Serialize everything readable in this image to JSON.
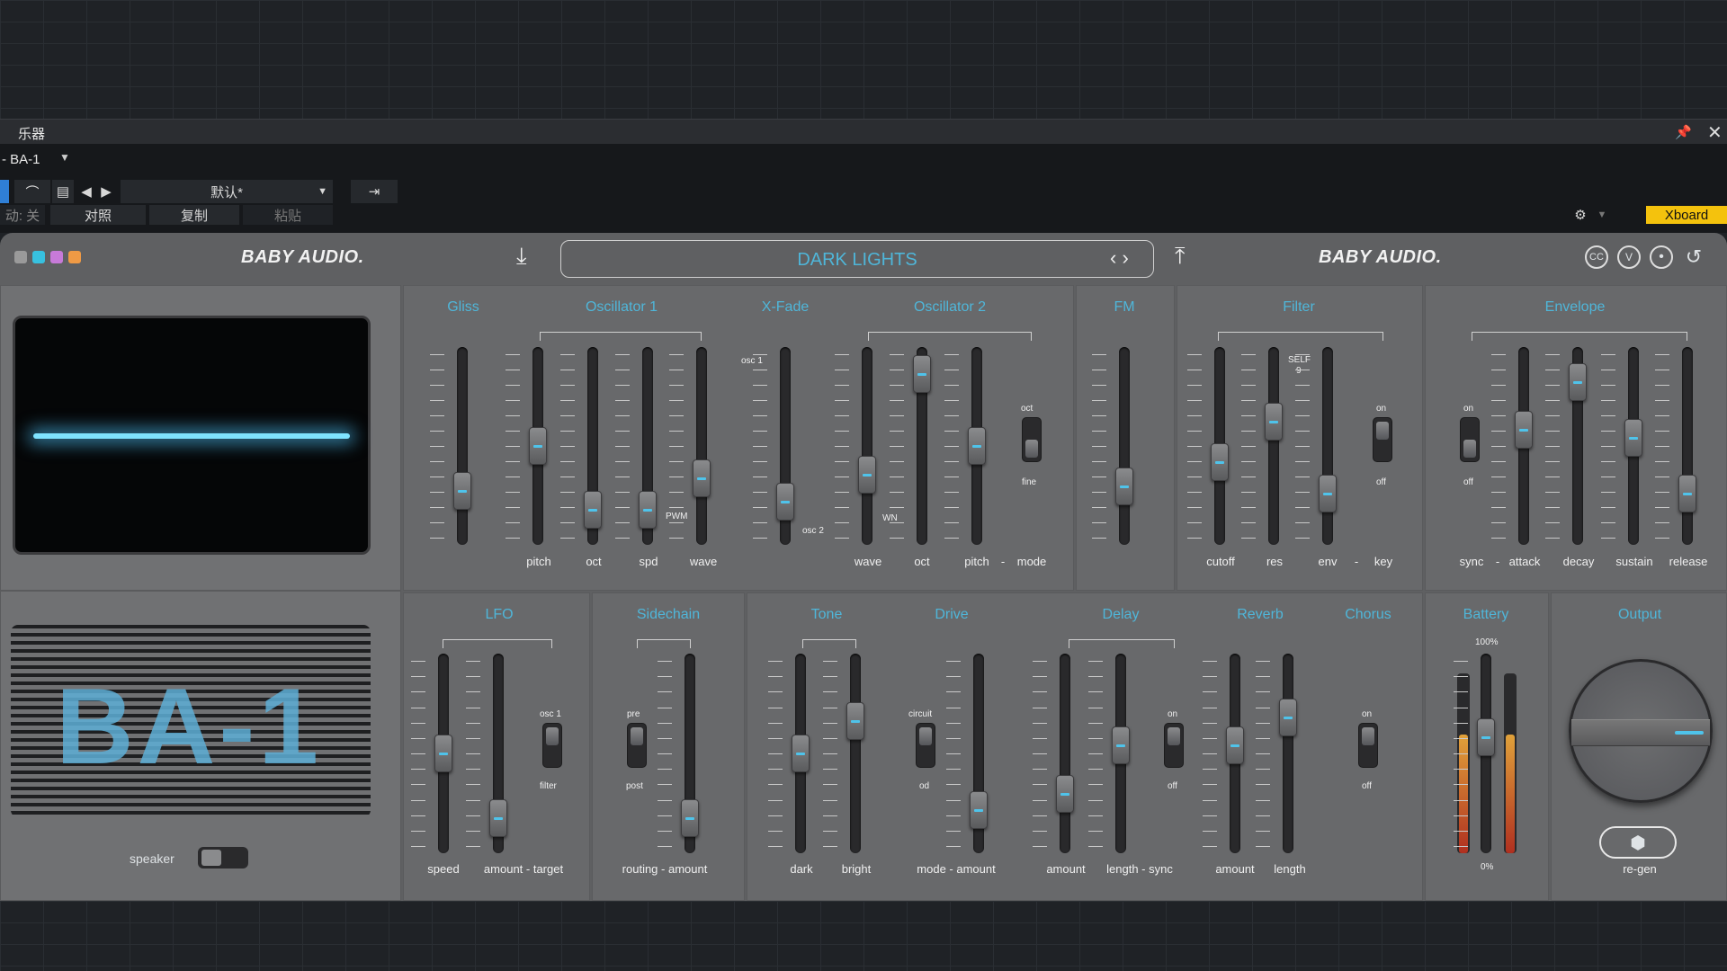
{
  "host": {
    "panel_title": "乐器",
    "track_name": "- BA-1",
    "preset_menu": "默认*",
    "auto_label": "动: 关",
    "compare_label": "对照",
    "copy_label": "复制",
    "paste_label": "粘贴",
    "xboard_label": "Xboard"
  },
  "synth": {
    "brand_left": "BABY AUDIO.",
    "brand_right": "BABY AUDIO.",
    "preset_name": "DARK LIGHTS",
    "color_dots": [
      "#9a9a9a",
      "#37c1df",
      "#c77ad8",
      "#ef9a45"
    ],
    "speaker_label": "speaker",
    "sections": {
      "gliss": "Gliss",
      "osc1": "Oscillator 1",
      "xfade": "X-Fade",
      "osc2": "Oscillator 2",
      "fm": "FM",
      "filter": "Filter",
      "envelope": "Envelope",
      "lfo": "LFO",
      "sidechain": "Sidechain",
      "tone": "Tone",
      "drive": "Drive",
      "delay": "Delay",
      "reverb": "Reverb",
      "chorus": "Chorus",
      "battery": "Battery",
      "output": "Output"
    },
    "labels": {
      "pitch": "pitch",
      "oct": "oct",
      "spd": "spd",
      "wave": "wave",
      "wave2": "wave",
      "oct2": "oct",
      "pitch2": "pitch",
      "mode": "mode",
      "dash": "-",
      "cutoff": "cutoff",
      "res": "res",
      "env": "env",
      "key": "key",
      "sync": "sync",
      "attack": "attack",
      "decay": "decay",
      "sustain": "sustain",
      "release": "release",
      "speed": "speed",
      "amount_target": "amount - target",
      "routing_amount": "routing - amount",
      "dark": "dark",
      "bright": "bright",
      "mode_amount": "mode - amount",
      "delay_amount": "amount",
      "length_sync": "length - sync",
      "rev_amount": "amount",
      "rev_length": "length",
      "regen": "re-gen",
      "on": "on",
      "off": "off",
      "fine": "fine",
      "octsw": "oct",
      "pre": "pre",
      "post": "post",
      "circuit": "circuit",
      "od": "od",
      "osc1": "osc 1",
      "filter_sw": "filter",
      "osc1b": "osc 1",
      "osc2b": "osc 2",
      "pwm": "PWM",
      "wn": "WN",
      "self9": "SELF\n9",
      "pct100": "100%",
      "pct0": "0%"
    },
    "scale": {
      "ten": "10",
      "zero": "0",
      "plus": "+",
      "minus": "-",
      "four": "4",
      "eight": "8",
      "sixteen": "16",
      "thirtytwo": "32",
      "f": "F",
      "s": "S",
      "p10": "+10",
      "m10": "-10"
    },
    "levels": {
      "gliss": 0.22,
      "pitch": 0.5,
      "oct": 0.1,
      "spd": 0.1,
      "wave": 0.3,
      "xfade": 0.15,
      "wave2": 0.32,
      "oct2": 0.95,
      "pitch2": 0.5,
      "fm": 0.25,
      "cutoff": 0.4,
      "res": 0.65,
      "env": 0.2,
      "attack": 0.6,
      "decay": 0.9,
      "sustain": 0.55,
      "release": 0.2,
      "lfo_speed": 0.5,
      "lfo_amt": 0.1,
      "sidechain": 0.1,
      "dark": 0.5,
      "bright": 0.7,
      "drive": 0.15,
      "delay_amt": 0.25,
      "delay_len": 0.55,
      "rev_amt": 0.55,
      "rev_len": 0.72,
      "battery": 0.6
    }
  }
}
